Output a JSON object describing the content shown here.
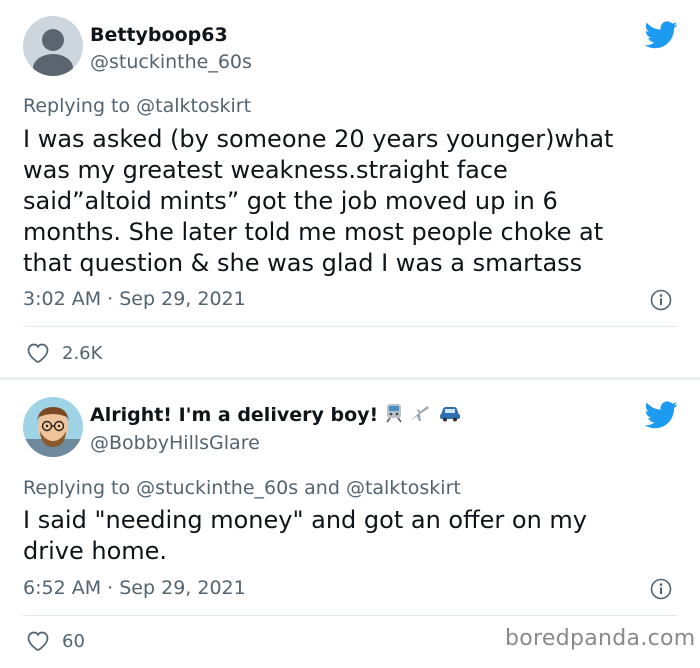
{
  "tweets": [
    {
      "display_name": "Bettyboop63",
      "handle": "@stuckinthe_60s",
      "replying_prefix": "Replying to",
      "replying_to": "@talktoskirt",
      "replying_conjunction": "",
      "replying_to_2": "",
      "text": "I was asked (by someone 20 years younger)what\nwas my greatest weakness.straight face\nsaid”altoid mints” got the job moved up in 6\nmonths. She later told me most people choke at\nthat question & she was glad I was a smartass",
      "time": "3:02 AM",
      "dot": "·",
      "date": "Sep 29, 2021",
      "likes": "2.6K",
      "avatar_icon": "default-avatar-icon"
    },
    {
      "display_name": "Alright! I'm a delivery boy!",
      "handle": "@BobbyHillsGlare",
      "replying_prefix": "Replying to",
      "replying_to": "@stuckinthe_60s",
      "replying_conjunction": "and",
      "replying_to_2": "@talktoskirt",
      "text": "I said \"needing money\" and got an offer on my\ndrive home.",
      "time": "6:52 AM",
      "dot": "·",
      "date": "Sep 29, 2021",
      "likes": "60",
      "name_emojis": [
        "train-emoji",
        "airplane-emoji",
        "car-emoji"
      ],
      "avatar_icon": "cartoon-man-avatar"
    }
  ],
  "watermark": "boredpanda.com",
  "colors": {
    "twitter_blue": "#1d9bf0",
    "secondary_text": "#536471",
    "separator": "#eceff1"
  }
}
